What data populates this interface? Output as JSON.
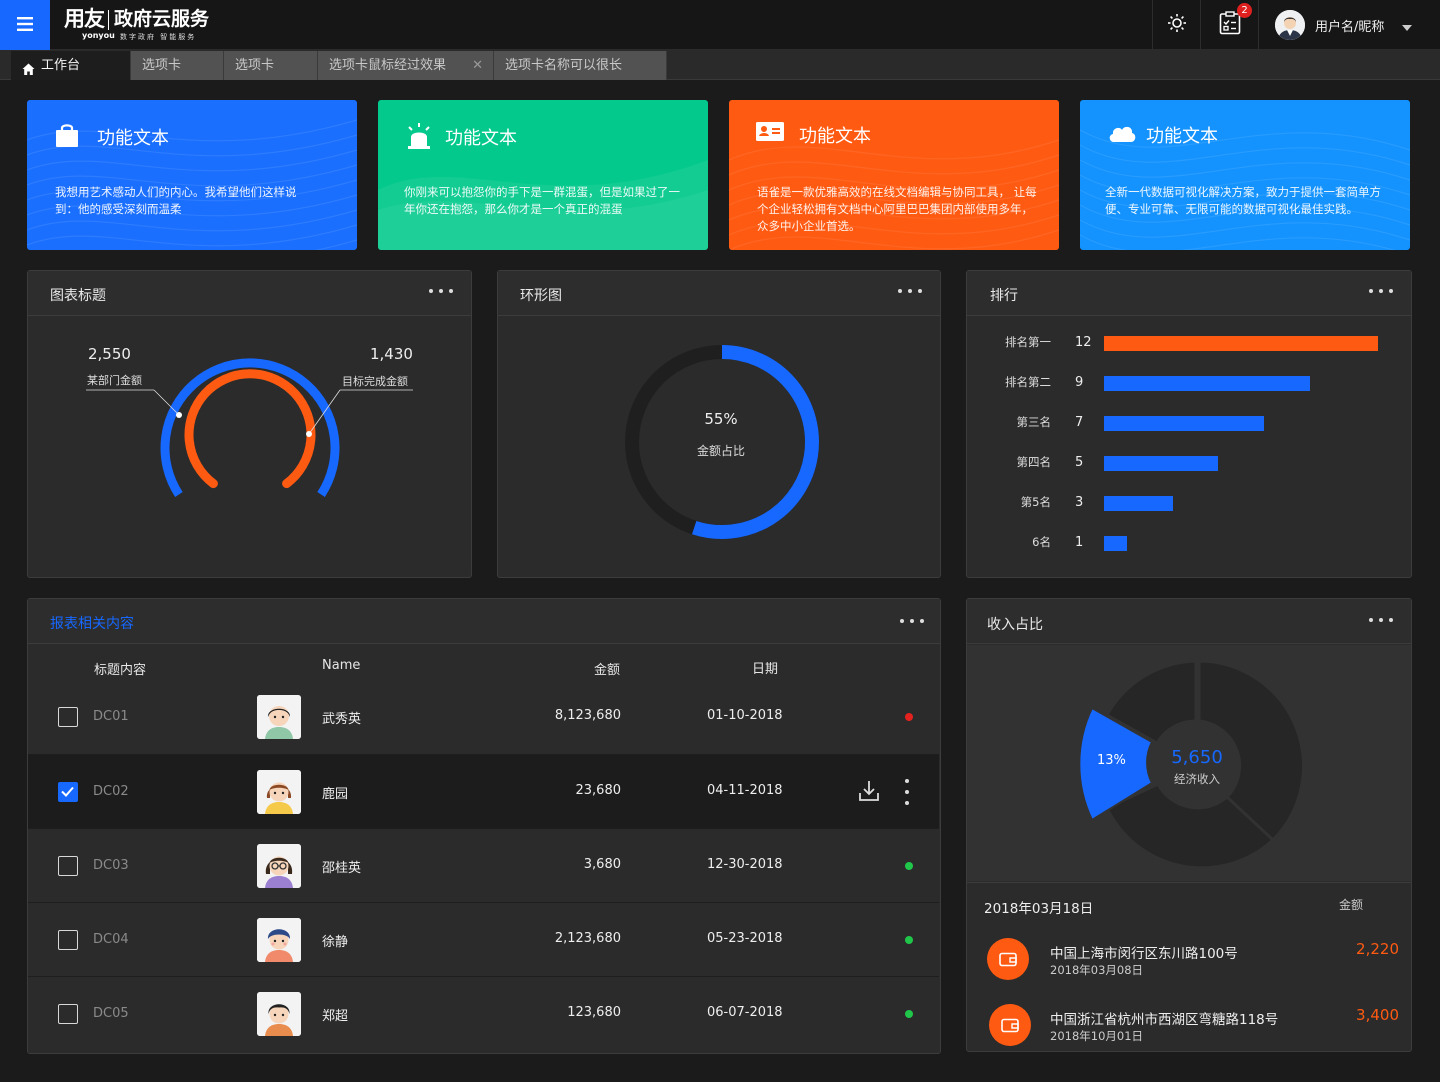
{
  "header": {
    "logo_main": "用友",
    "logo_sub": "yonyou",
    "logo_title": "政府云服务",
    "logo_tagline": "数字政府 智能服务",
    "notification_count": "2",
    "user_name": "用户名/昵称"
  },
  "tabs": [
    {
      "label": "工作台",
      "active": true
    },
    {
      "label": "选项卡",
      "active": false
    },
    {
      "label": "选项卡",
      "active": false
    },
    {
      "label": "选项卡鼠标经过效果",
      "active": false,
      "closable": true
    },
    {
      "label": "选项卡名称可以很长",
      "active": false
    }
  ],
  "feature_cards": [
    {
      "icon": "shopping-bag-icon",
      "color": "#1a6fff",
      "title": "功能文本",
      "desc": "我想用艺术感动人们的内心。我希望他们这样说到：他的感受深刻而温柔"
    },
    {
      "icon": "alarm-light-icon",
      "color": "#04c98c",
      "title": "功能文本",
      "desc": "你刚来可以抱怨你的手下是一群混蛋，但是如果过了一年你还在抱怨，那么你才是一个真正的混蛋"
    },
    {
      "icon": "id-card-icon",
      "color": "#ff5a12",
      "title": "功能文本",
      "desc": "语雀是一款优雅高效的在线文档编辑与协同工具， 让每个企业轻松拥有文档中心阿里巴巴集团内部使用多年，众多中小企业首选。"
    },
    {
      "icon": "cloud-icon",
      "color": "#1493ff",
      "title": "功能文本",
      "desc": "全新一代数据可视化解决方案，致力于提供一套简单方便、专业可靠、无限可能的数据可视化最佳实践。"
    }
  ],
  "panels": {
    "gauge_title": "图表标题",
    "donut_title": "环形图",
    "rank_title": "排行",
    "table_title": "报表相关内容",
    "income_title": "收入占比"
  },
  "gauge": {
    "outer_value": "2,550",
    "outer_label": "某部门金额",
    "inner_value": "1,430",
    "inner_label": "目标完成金额"
  },
  "donut": {
    "percent": 55,
    "percent_label": "55%",
    "label": "金额占比"
  },
  "ranking": [
    {
      "name": "排名第一",
      "value": 12,
      "color": "#ff5a12"
    },
    {
      "name": "排名第二",
      "value": 9,
      "color": "#1668ff"
    },
    {
      "name": "第三名",
      "value": 7,
      "color": "#1668ff"
    },
    {
      "name": "第四名",
      "value": 5,
      "color": "#1668ff"
    },
    {
      "name": "第5名",
      "value": 3,
      "color": "#1668ff"
    },
    {
      "name": "6名",
      "value": 1,
      "color": "#1668ff"
    }
  ],
  "table": {
    "headers": {
      "title": "标题内容",
      "name": "Name",
      "amount": "金额",
      "date": "日期"
    },
    "rows": [
      {
        "code": "DC01",
        "name": "武秀英",
        "amount": "8,123,680",
        "date": "01-10-2018",
        "checked": false,
        "status": "#e3221f"
      },
      {
        "code": "DC02",
        "name": "鹿园",
        "amount": "23,680",
        "date": "04-11-2018",
        "checked": true,
        "status": null
      },
      {
        "code": "DC03",
        "name": "邵桂英",
        "amount": "3,680",
        "date": "12-30-2018",
        "checked": false,
        "status": "#1fc64a"
      },
      {
        "code": "DC04",
        "name": "徐静",
        "amount": "2,123,680",
        "date": "05-23-2018",
        "checked": false,
        "status": "#1fc64a"
      },
      {
        "code": "DC05",
        "name": "郑超",
        "amount": "123,680",
        "date": "06-07-2018",
        "checked": false,
        "status": "#1fc64a"
      }
    ]
  },
  "income": {
    "center_value": "5,650",
    "center_label": "经济收入",
    "highlight_percent": "13%",
    "list_date": "2018年03月18日",
    "list_amount_header": "金额",
    "items": [
      {
        "address": "中国上海市闵行区东川路100号",
        "date": "2018年03月08日",
        "amount": "2,220"
      },
      {
        "address": "中国浙江省杭州市西湖区弯糖路118号",
        "date": "2018年10月01日",
        "amount": "3,400"
      }
    ]
  }
}
